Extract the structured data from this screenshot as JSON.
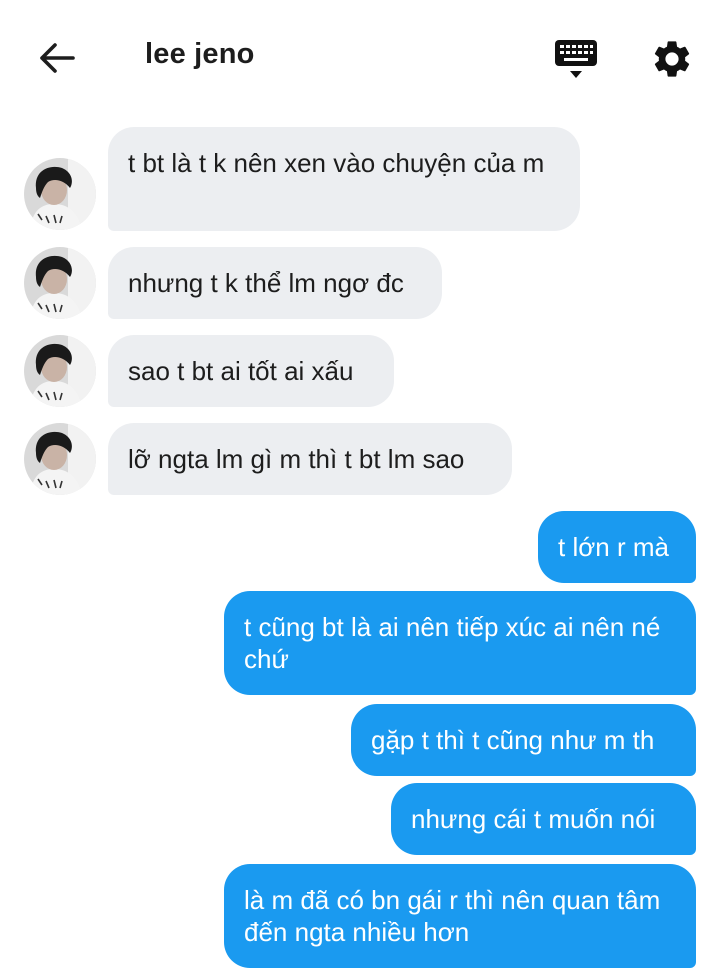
{
  "header": {
    "title": "lee jeno",
    "back_icon": "arrow-left-icon",
    "keyboard_icon": "keyboard-icon",
    "settings_icon": "gear-icon"
  },
  "colors": {
    "incoming_bubble": "#eceef1",
    "outgoing_bubble": "#1a9af0",
    "outgoing_text": "#ffffff"
  },
  "messages": [
    {
      "side": "incoming",
      "text": "t bt là t k nên xen vào chuyện của m"
    },
    {
      "side": "incoming",
      "text": "nhưng t k thể lm ngơ đc"
    },
    {
      "side": "incoming",
      "text": "sao t bt ai tốt ai xấu"
    },
    {
      "side": "incoming",
      "text": "lỡ ngta lm gì m thì t bt lm sao"
    },
    {
      "side": "outgoing",
      "text": "t lớn r mà"
    },
    {
      "side": "outgoing",
      "text": "t cũng bt là ai nên tiếp xúc ai nên né chứ"
    },
    {
      "side": "outgoing",
      "text": "gặp t thì t cũng như m th"
    },
    {
      "side": "outgoing",
      "text": "nhưng cái t muốn nói"
    },
    {
      "side": "outgoing",
      "text": "là m đã có bn gái r thì nên quan tâm đến ngta nhiều hơn"
    }
  ]
}
